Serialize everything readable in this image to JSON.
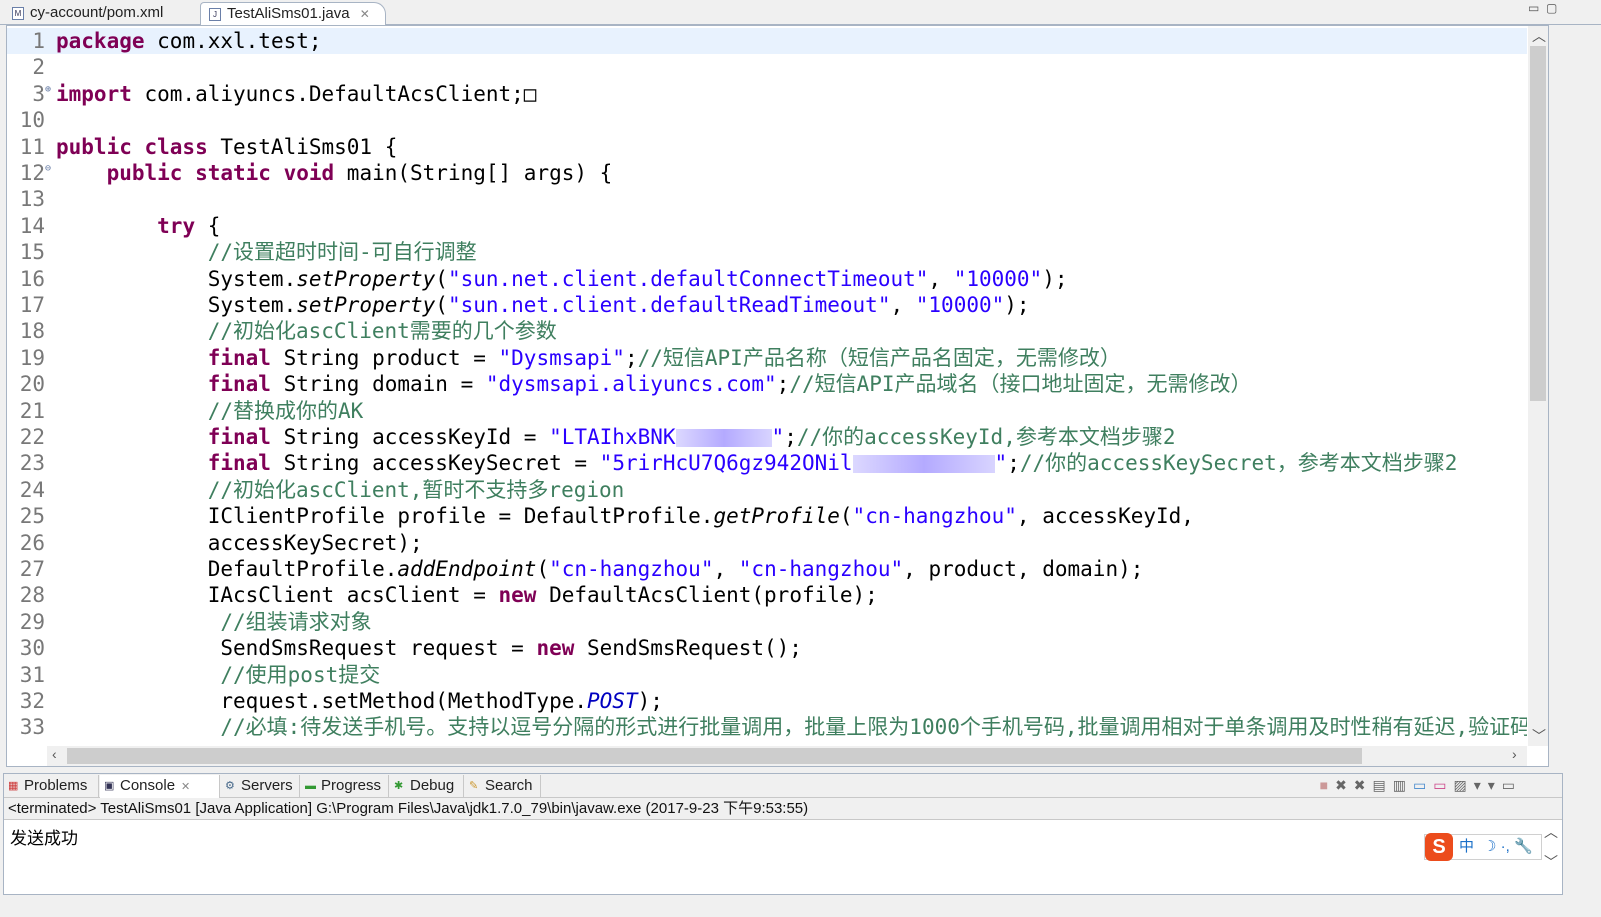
{
  "editor_tabs": [
    {
      "label": "cy-account/pom.xml",
      "icon": "maven-file-icon",
      "active": false
    },
    {
      "label": "TestAliSms01.java",
      "icon": "java-file-icon",
      "active": true
    }
  ],
  "code_colors": {
    "keyword": "#7f0055",
    "string": "#2a00ff",
    "comment": "#3f7f5f",
    "line_number": "#787878"
  },
  "code_lines": [
    {
      "n": "1",
      "cur": true,
      "t": [
        [
          "k",
          "package"
        ],
        [
          "p",
          " com.xxl.test;"
        ]
      ]
    },
    {
      "n": "2",
      "t": []
    },
    {
      "n": "3",
      "m": "⊕",
      "t": [
        [
          "k",
          "import"
        ],
        [
          "p",
          " com.aliyuncs.DefaultAcsClient;□"
        ]
      ]
    },
    {
      "n": "10",
      "t": []
    },
    {
      "n": "11",
      "t": [
        [
          "k",
          "public class"
        ],
        [
          "p",
          " TestAliSms01 {"
        ]
      ]
    },
    {
      "n": "12",
      "m": "⊖",
      "t": [
        [
          "p",
          "    "
        ],
        [
          "k",
          "public static void"
        ],
        [
          "p",
          " main(String[] args) {"
        ]
      ]
    },
    {
      "n": "13",
      "t": []
    },
    {
      "n": "14",
      "t": [
        [
          "p",
          "        "
        ],
        [
          "k",
          "try"
        ],
        [
          "p",
          " {"
        ]
      ]
    },
    {
      "n": "15",
      "t": [
        [
          "p",
          "            "
        ],
        [
          "c",
          "//设置超时时间-可自行调整"
        ]
      ]
    },
    {
      "n": "16",
      "t": [
        [
          "p",
          "            System."
        ],
        [
          "i",
          "setProperty"
        ],
        [
          "p",
          "("
        ],
        [
          "s",
          "\"sun.net.client.defaultConnectTimeout\""
        ],
        [
          "p",
          ", "
        ],
        [
          "s",
          "\"10000\""
        ],
        [
          "p",
          ");"
        ]
      ]
    },
    {
      "n": "17",
      "t": [
        [
          "p",
          "            System."
        ],
        [
          "i",
          "setProperty"
        ],
        [
          "p",
          "("
        ],
        [
          "s",
          "\"sun.net.client.defaultReadTimeout\""
        ],
        [
          "p",
          ", "
        ],
        [
          "s",
          "\"10000\""
        ],
        [
          "p",
          ");"
        ]
      ]
    },
    {
      "n": "18",
      "t": [
        [
          "p",
          "            "
        ],
        [
          "c",
          "//初始化ascClient需要的几个参数"
        ]
      ]
    },
    {
      "n": "19",
      "t": [
        [
          "p",
          "            "
        ],
        [
          "k",
          "final"
        ],
        [
          "p",
          " String product = "
        ],
        [
          "s",
          "\"Dysmsapi\""
        ],
        [
          "p",
          ";"
        ],
        [
          "c",
          "//短信API产品名称（短信产品名固定，无需修改）"
        ]
      ]
    },
    {
      "n": "20",
      "t": [
        [
          "p",
          "            "
        ],
        [
          "k",
          "final"
        ],
        [
          "p",
          " String domain = "
        ],
        [
          "s",
          "\"dysmsapi.aliyuncs.com\""
        ],
        [
          "p",
          ";"
        ],
        [
          "c",
          "//短信API产品域名（接口地址固定，无需修改）"
        ]
      ]
    },
    {
      "n": "21",
      "t": [
        [
          "p",
          "            "
        ],
        [
          "c",
          "//替换成你的AK"
        ]
      ]
    },
    {
      "n": "22",
      "t": [
        [
          "p",
          "            "
        ],
        [
          "k",
          "final"
        ],
        [
          "p",
          " String accessKeyId = "
        ],
        [
          "s",
          "\"LTAIhxBNK"
        ],
        [
          "r",
          ""
        ],
        [
          "s",
          "\""
        ],
        [
          "p",
          ";"
        ],
        [
          "c",
          "//你的accessKeyId,参考本文档步骤2"
        ]
      ]
    },
    {
      "n": "23",
      "t": [
        [
          "p",
          "            "
        ],
        [
          "k",
          "final"
        ],
        [
          "p",
          " String accessKeySecret = "
        ],
        [
          "s",
          "\"5rirHcU7Q6gz942ONil"
        ],
        [
          "r2",
          ""
        ],
        [
          "s",
          "\""
        ],
        [
          "p",
          ";"
        ],
        [
          "c",
          "//你的accessKeySecret，参考本文档步骤2"
        ]
      ]
    },
    {
      "n": "24",
      "t": [
        [
          "p",
          "            "
        ],
        [
          "c",
          "//初始化ascClient,暂时不支持多region"
        ]
      ]
    },
    {
      "n": "25",
      "t": [
        [
          "p",
          "            IClientProfile profile = DefaultProfile."
        ],
        [
          "i",
          "getProfile"
        ],
        [
          "p",
          "("
        ],
        [
          "s",
          "\"cn-hangzhou\""
        ],
        [
          "p",
          ", accessKeyId,"
        ]
      ]
    },
    {
      "n": "26",
      "t": [
        [
          "p",
          "            accessKeySecret);"
        ]
      ]
    },
    {
      "n": "27",
      "t": [
        [
          "p",
          "            DefaultProfile."
        ],
        [
          "i",
          "addEndpoint"
        ],
        [
          "p",
          "("
        ],
        [
          "s",
          "\"cn-hangzhou\""
        ],
        [
          "p",
          ", "
        ],
        [
          "s",
          "\"cn-hangzhou\""
        ],
        [
          "p",
          ", product, domain);"
        ]
      ]
    },
    {
      "n": "28",
      "t": [
        [
          "p",
          "            IAcsClient acsClient = "
        ],
        [
          "k",
          "new"
        ],
        [
          "p",
          " DefaultAcsClient(profile);"
        ]
      ]
    },
    {
      "n": "29",
      "t": [
        [
          "p",
          "             "
        ],
        [
          "c",
          "//组装请求对象"
        ]
      ]
    },
    {
      "n": "30",
      "t": [
        [
          "p",
          "             SendSmsRequest request = "
        ],
        [
          "k",
          "new"
        ],
        [
          "p",
          " SendSmsRequest();"
        ]
      ]
    },
    {
      "n": "31",
      "t": [
        [
          "p",
          "             "
        ],
        [
          "c",
          "//使用post提交"
        ]
      ]
    },
    {
      "n": "32",
      "t": [
        [
          "p",
          "             request.setMethod(MethodType."
        ],
        [
          "f",
          "POST"
        ],
        [
          "p",
          ");"
        ]
      ]
    },
    {
      "n": "33",
      "t": [
        [
          "p",
          "             "
        ],
        [
          "c",
          "//必填:待发送手机号。支持以逗号分隔的形式进行批量调用，批量上限为1000个手机号码,批量调用相对于单条调用及时性稍有延迟,验证码类型的短信推荐"
        ]
      ]
    }
  ],
  "console": {
    "tabs": [
      {
        "label": "Problems",
        "icon": "problems-icon"
      },
      {
        "label": "Console",
        "icon": "console-icon",
        "active": true
      },
      {
        "label": "Servers",
        "icon": "servers-icon"
      },
      {
        "label": "Progress",
        "icon": "progress-icon"
      },
      {
        "label": "Debug",
        "icon": "debug-icon"
      },
      {
        "label": "Search",
        "icon": "search-icon"
      }
    ],
    "status": "<terminated> TestAliSms01 [Java Application] G:\\Program Files\\Java\\jdk1.7.0_79\\bin\\javaw.exe (2017-9-23 下午9:53:55)",
    "output": "发送成功"
  },
  "ime": {
    "logo": "S",
    "mode": "中",
    "icons": "☽ ·, 🔧"
  }
}
